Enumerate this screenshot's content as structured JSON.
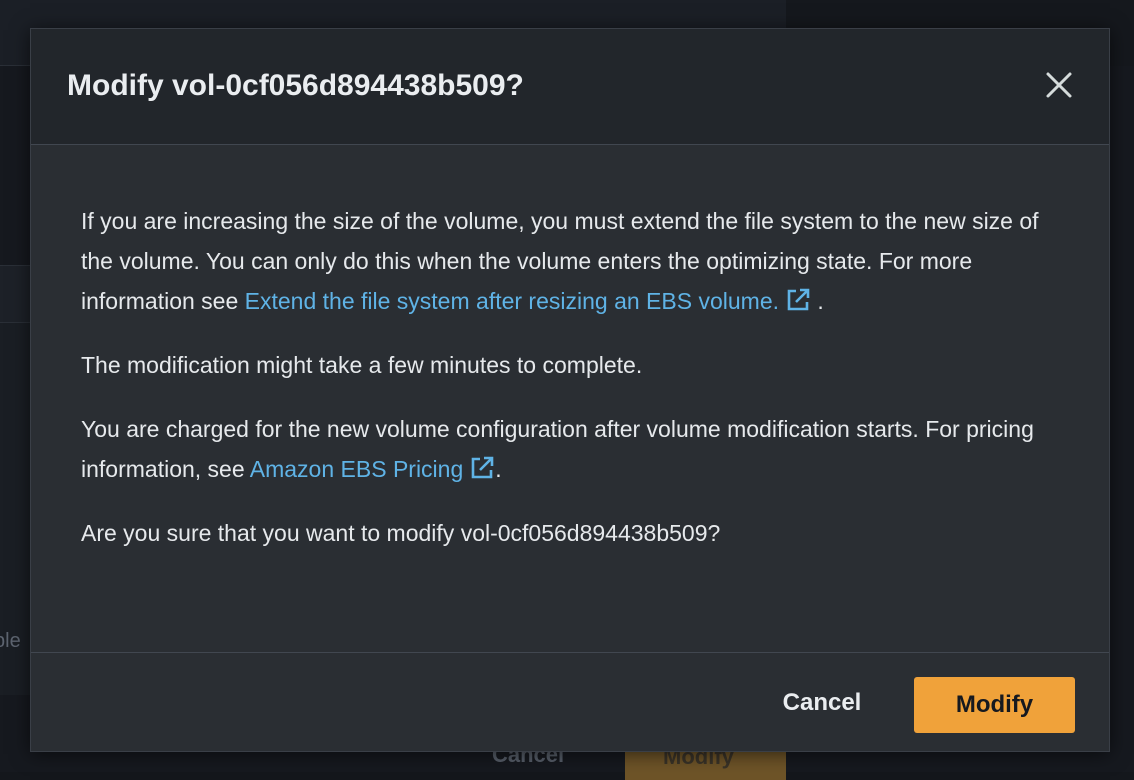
{
  "background": {
    "fragment_text": "ble",
    "cancel_label": "Cancel",
    "modify_label": "Modify"
  },
  "modal": {
    "title": "Modify vol-0cf056d894438b509?",
    "paragraph1": {
      "text": "If you are increasing the size of the volume, you must extend the file system to the new size of the volume. You can only do this when the volume enters the optimizing state. For more information see ",
      "link": "Extend the file system after resizing an EBS volume.",
      "suffix": " ."
    },
    "paragraph2": "The modification might take a few minutes to complete.",
    "paragraph3": {
      "text": "You are charged for the new volume configuration after volume modification starts. For pricing information, see ",
      "link": "Amazon EBS Pricing",
      "suffix": "."
    },
    "paragraph4": "Are you sure that you want to modify vol-0cf056d894438b509?",
    "cancel_label": "Cancel",
    "modify_label": "Modify"
  },
  "icons": {
    "close": "close-icon",
    "external_link": "external-link-icon"
  },
  "colors": {
    "accent": "#f0a23a",
    "link": "#5fb3e6",
    "modal_bg": "#2a2e33",
    "header_bg": "#22262b"
  }
}
